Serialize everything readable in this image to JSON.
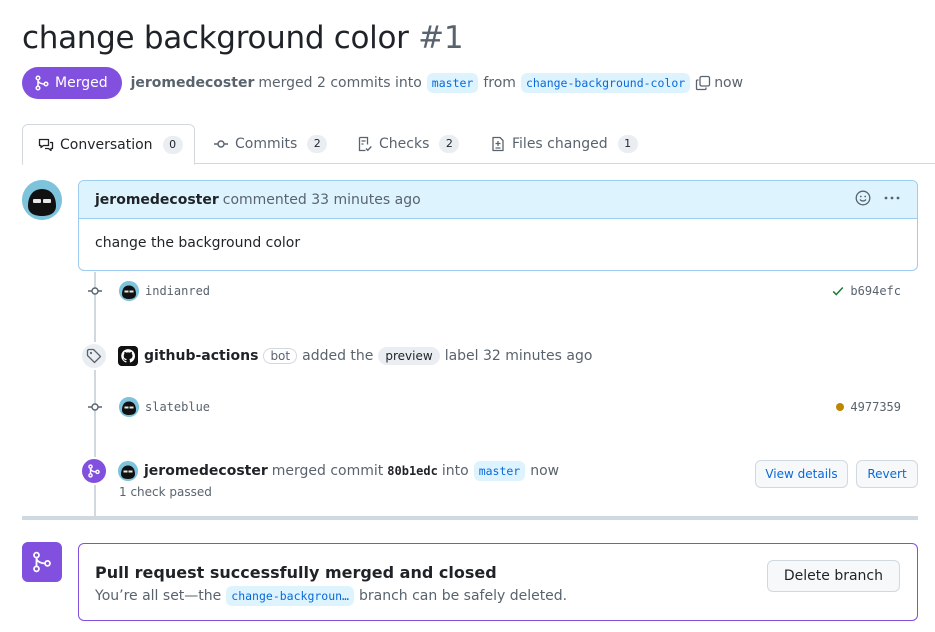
{
  "header": {
    "title": "change background color",
    "number": "#1",
    "state": "Merged",
    "author": "jeromedecoster",
    "action_text": "merged 2 commits into",
    "base_branch": "master",
    "from_text": "from",
    "head_branch": "change-background-color",
    "time": "now"
  },
  "tabs": [
    {
      "label": "Conversation",
      "count": "0"
    },
    {
      "label": "Commits",
      "count": "2"
    },
    {
      "label": "Checks",
      "count": "2"
    },
    {
      "label": "Files changed",
      "count": "1"
    }
  ],
  "comment": {
    "author": "jeromedecoster",
    "meta": "commented 33 minutes ago",
    "body": "change the background color"
  },
  "commits": [
    {
      "message": "indianred",
      "sha": "b694efc",
      "status": "success"
    },
    {
      "message": "slateblue",
      "sha": "4977359",
      "status": "pending"
    }
  ],
  "label_event": {
    "actor": "github-actions",
    "bot": "bot",
    "action": "added the",
    "label": "preview",
    "suffix": "label 32 minutes ago"
  },
  "merge_event": {
    "actor": "jeromedecoster",
    "action": "merged commit",
    "sha": "80b1edc",
    "into": "into",
    "branch": "master",
    "time": "now",
    "checks": "1 check passed",
    "view_details": "View details",
    "revert": "Revert"
  },
  "merged_box": {
    "title": "Pull request successfully merged and closed",
    "desc_prefix": "You’re all set—the",
    "branch": "change-backgroun…",
    "desc_suffix": "branch can be safely deleted.",
    "delete_button": "Delete branch"
  },
  "colors": {
    "merged": "#8250df",
    "branch_bg": "#ddf4ff",
    "branch_fg": "#0969da",
    "success": "#1a7f37",
    "pending": "#bf8700"
  }
}
